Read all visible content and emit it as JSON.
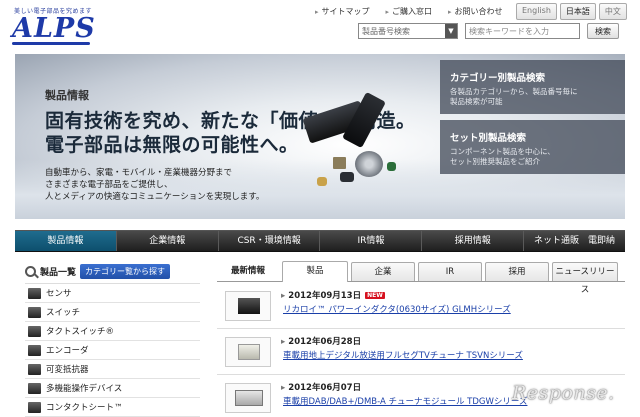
{
  "brand": {
    "tagline": "美しい電子部品を究めます",
    "logo": "ALPS"
  },
  "toplinks": [
    "サイトマップ",
    "ご購入窓口",
    "お問い合わせ"
  ],
  "languages": [
    "English",
    "日本語",
    "中文"
  ],
  "search": {
    "select_value": "製品番号検索",
    "keyword_placeholder": "検索キーワードを入力",
    "button_label": "検索"
  },
  "hero": {
    "eyebrow": "製品情報",
    "title_line1": "固有技術を究め、新たな「価値」を創造。",
    "title_line2": "電子部品は無限の可能性へ。",
    "body": [
      "自動車から、家電・モバイル・産業機器分野まで",
      "さまざまな電子部品をご提供し、",
      "人とメディアの快適なコミュニケーションを実現します。"
    ],
    "panels": [
      {
        "title": "カテゴリー別製品検索",
        "desc": [
          "各製品カテゴリーから、製品番号毎に",
          "製品検索が可能"
        ]
      },
      {
        "title": "セット別製品検索",
        "desc": [
          "コンポーネント製品を中心に、",
          "セット別推奨製品をご紹介"
        ]
      }
    ]
  },
  "nav": [
    "製品情報",
    "企業情報",
    "CSR・環境情報",
    "IR情報",
    "採用情報",
    "ネット通販　電即納"
  ],
  "sidebar": {
    "heading": "製品一覧",
    "category_button": "カテゴリー覧から探す",
    "items": [
      "センサ",
      "スイッチ",
      "タクトスイッチ®",
      "エンコーダ",
      "可変抵抗器",
      "多機能操作デバイス",
      "コンタクトシート™"
    ]
  },
  "tabs": [
    "最新情報",
    "製品",
    "企業",
    "IR",
    "採用",
    "ニュースリリース"
  ],
  "news": [
    {
      "date": "2012年09月13日",
      "is_new": true,
      "badge": "NEW",
      "title": "リカロイ™ パワーインダクタ(0630サイズ) GLMHシリーズ"
    },
    {
      "date": "2012年06月28日",
      "is_new": false,
      "badge": "",
      "title": "車載用地上デジタル放送用フルセグTVチューナ TSVNシリーズ"
    },
    {
      "date": "2012年06月07日",
      "is_new": false,
      "badge": "",
      "title": "車載用DAB/DAB+/DMB-A チューナモジュール TDGWシリーズ"
    }
  ],
  "watermark": "Response.",
  "colors": {
    "brand_blue": "#1e3aa8",
    "nav_active": "#0d4f6d",
    "link": "#1a3fa8",
    "new_badge": "#d6111f"
  }
}
